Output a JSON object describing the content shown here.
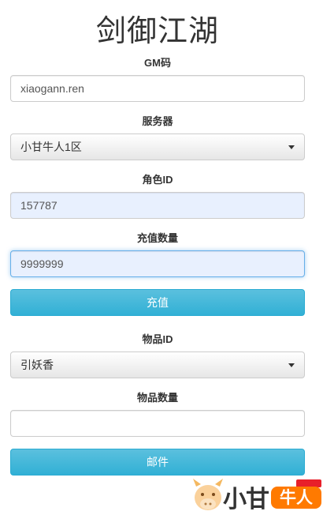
{
  "page": {
    "title": "剑御江湖"
  },
  "form": {
    "gm_code": {
      "label": "GM码",
      "value": "xiaogann.ren"
    },
    "server": {
      "label": "服务器",
      "selected": "小甘牛人1区"
    },
    "role_id": {
      "label": "角色ID",
      "value": "157787"
    },
    "recharge_amount": {
      "label": "充值数量",
      "value": "9999999"
    },
    "recharge_button": "充值",
    "item_id": {
      "label": "物品ID",
      "selected": "引妖香"
    },
    "item_quantity": {
      "label": "物品数量",
      "value": ""
    },
    "mail_button": "邮件"
  },
  "watermark": {
    "text": "小甘",
    "badge": "牛人",
    "icon": "cow-mascot-icon",
    "colors": {
      "badge": "#ff7a00",
      "tag": "#e8202a"
    }
  },
  "colors": {
    "primary_button": "#31b0d5",
    "autofill_bg": "#e8f0fe",
    "focus_border": "#66afe9"
  }
}
